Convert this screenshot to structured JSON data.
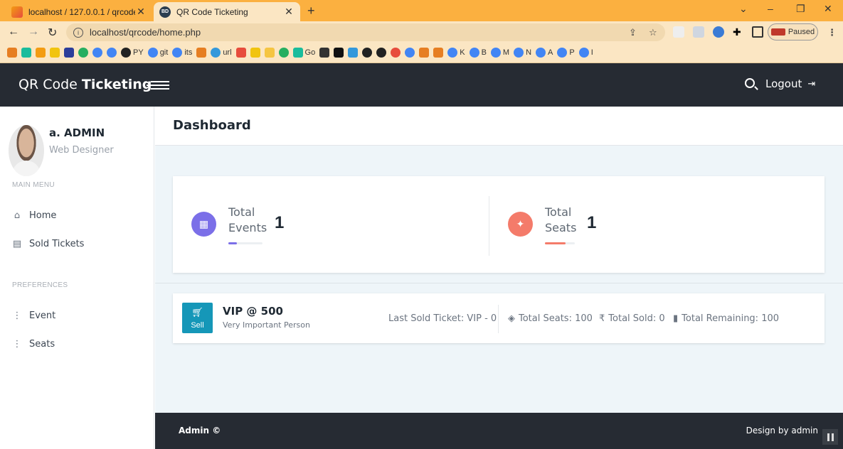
{
  "browser": {
    "tabs": [
      {
        "title": "localhost / 127.0.0.1 / qrcode / u",
        "active": false
      },
      {
        "title": "QR Code Ticketing",
        "active": true
      }
    ],
    "url": "localhost/qrcode/home.php",
    "profile_status": "Paused",
    "bookmarks": [
      "PY",
      "git",
      "its",
      "url",
      "Go",
      "K",
      "B",
      "M",
      "N",
      "A",
      "P",
      "I"
    ]
  },
  "app": {
    "brand_light": "QR Code ",
    "brand_bold": "Ticketing",
    "logout_label": "Logout"
  },
  "sidebar": {
    "user_name": "a. ADMIN",
    "user_role": "Web Designer",
    "main_menu_header": "MAIN MENU",
    "preferences_header": "PREFERENCES",
    "main_items": [
      {
        "label": "Home",
        "icon": "home-icon"
      },
      {
        "label": "Sold Tickets",
        "icon": "ticket-icon"
      }
    ],
    "pref_items": [
      {
        "label": "Event",
        "icon": "list-icon"
      },
      {
        "label": "Seats",
        "icon": "list-icon"
      }
    ]
  },
  "dashboard": {
    "title": "Dashboard",
    "stats": [
      {
        "label_line1": "Total",
        "label_line2": "Events",
        "value": "1",
        "color": "#7b6fe8",
        "progress": 0.25
      },
      {
        "label_line1": "Total",
        "label_line2": "Seats",
        "value": "1",
        "color": "#f47b6a",
        "progress": 0.7
      }
    ],
    "event": {
      "sell_label": "Sell",
      "name": "VIP @ 500",
      "description": "Very Important Person",
      "last_sold": "Last Sold Ticket: VIP - 0",
      "total_seats": "Total Seats: 100",
      "total_sold": "Total Sold: 0",
      "total_remaining": "Total Remaining: 100"
    }
  },
  "footer": {
    "left": "Admin ©",
    "right": "Design by admin"
  }
}
